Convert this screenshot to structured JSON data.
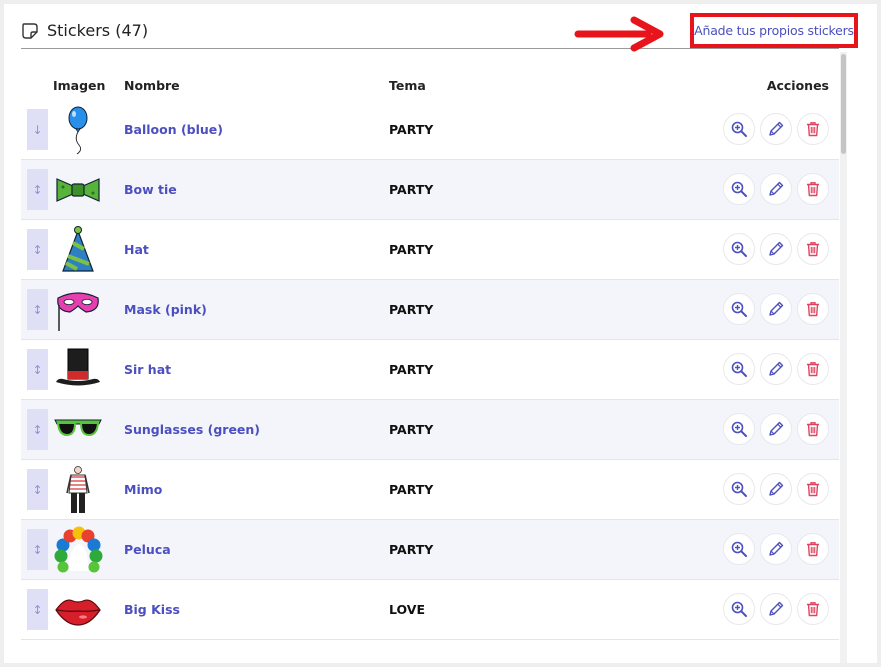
{
  "header": {
    "title": "Stickers (47)",
    "add_link": "Añade tus propios stickers",
    "icon": "sticker-icon"
  },
  "table": {
    "columns": {
      "image": "Imagen",
      "name": "Nombre",
      "theme": "Tema",
      "actions": "Acciones"
    },
    "rows": [
      {
        "name": "Balloon (blue)",
        "theme": "PARTY",
        "icon": "balloon-icon",
        "handle": "↓"
      },
      {
        "name": "Bow tie",
        "theme": "PARTY",
        "icon": "bow-tie-icon",
        "handle": "↕"
      },
      {
        "name": "Hat",
        "theme": "PARTY",
        "icon": "party-hat-icon",
        "handle": "↕"
      },
      {
        "name": "Mask (pink)",
        "theme": "PARTY",
        "icon": "mask-icon",
        "handle": "↕"
      },
      {
        "name": "Sir hat",
        "theme": "PARTY",
        "icon": "top-hat-icon",
        "handle": "↕"
      },
      {
        "name": "Sunglasses (green)",
        "theme": "PARTY",
        "icon": "sunglasses-icon",
        "handle": "↕"
      },
      {
        "name": "Mimo",
        "theme": "PARTY",
        "icon": "mime-icon",
        "handle": "↕"
      },
      {
        "name": "Peluca",
        "theme": "PARTY",
        "icon": "wig-icon",
        "handle": "↕"
      },
      {
        "name": "Big Kiss",
        "theme": "LOVE",
        "icon": "lips-icon",
        "handle": "↕"
      }
    ]
  },
  "colors": {
    "accent": "#4b4fbf",
    "highlight": "#e8141b",
    "delete": "#e0435f",
    "handle_bg": "#dfe0f5"
  }
}
